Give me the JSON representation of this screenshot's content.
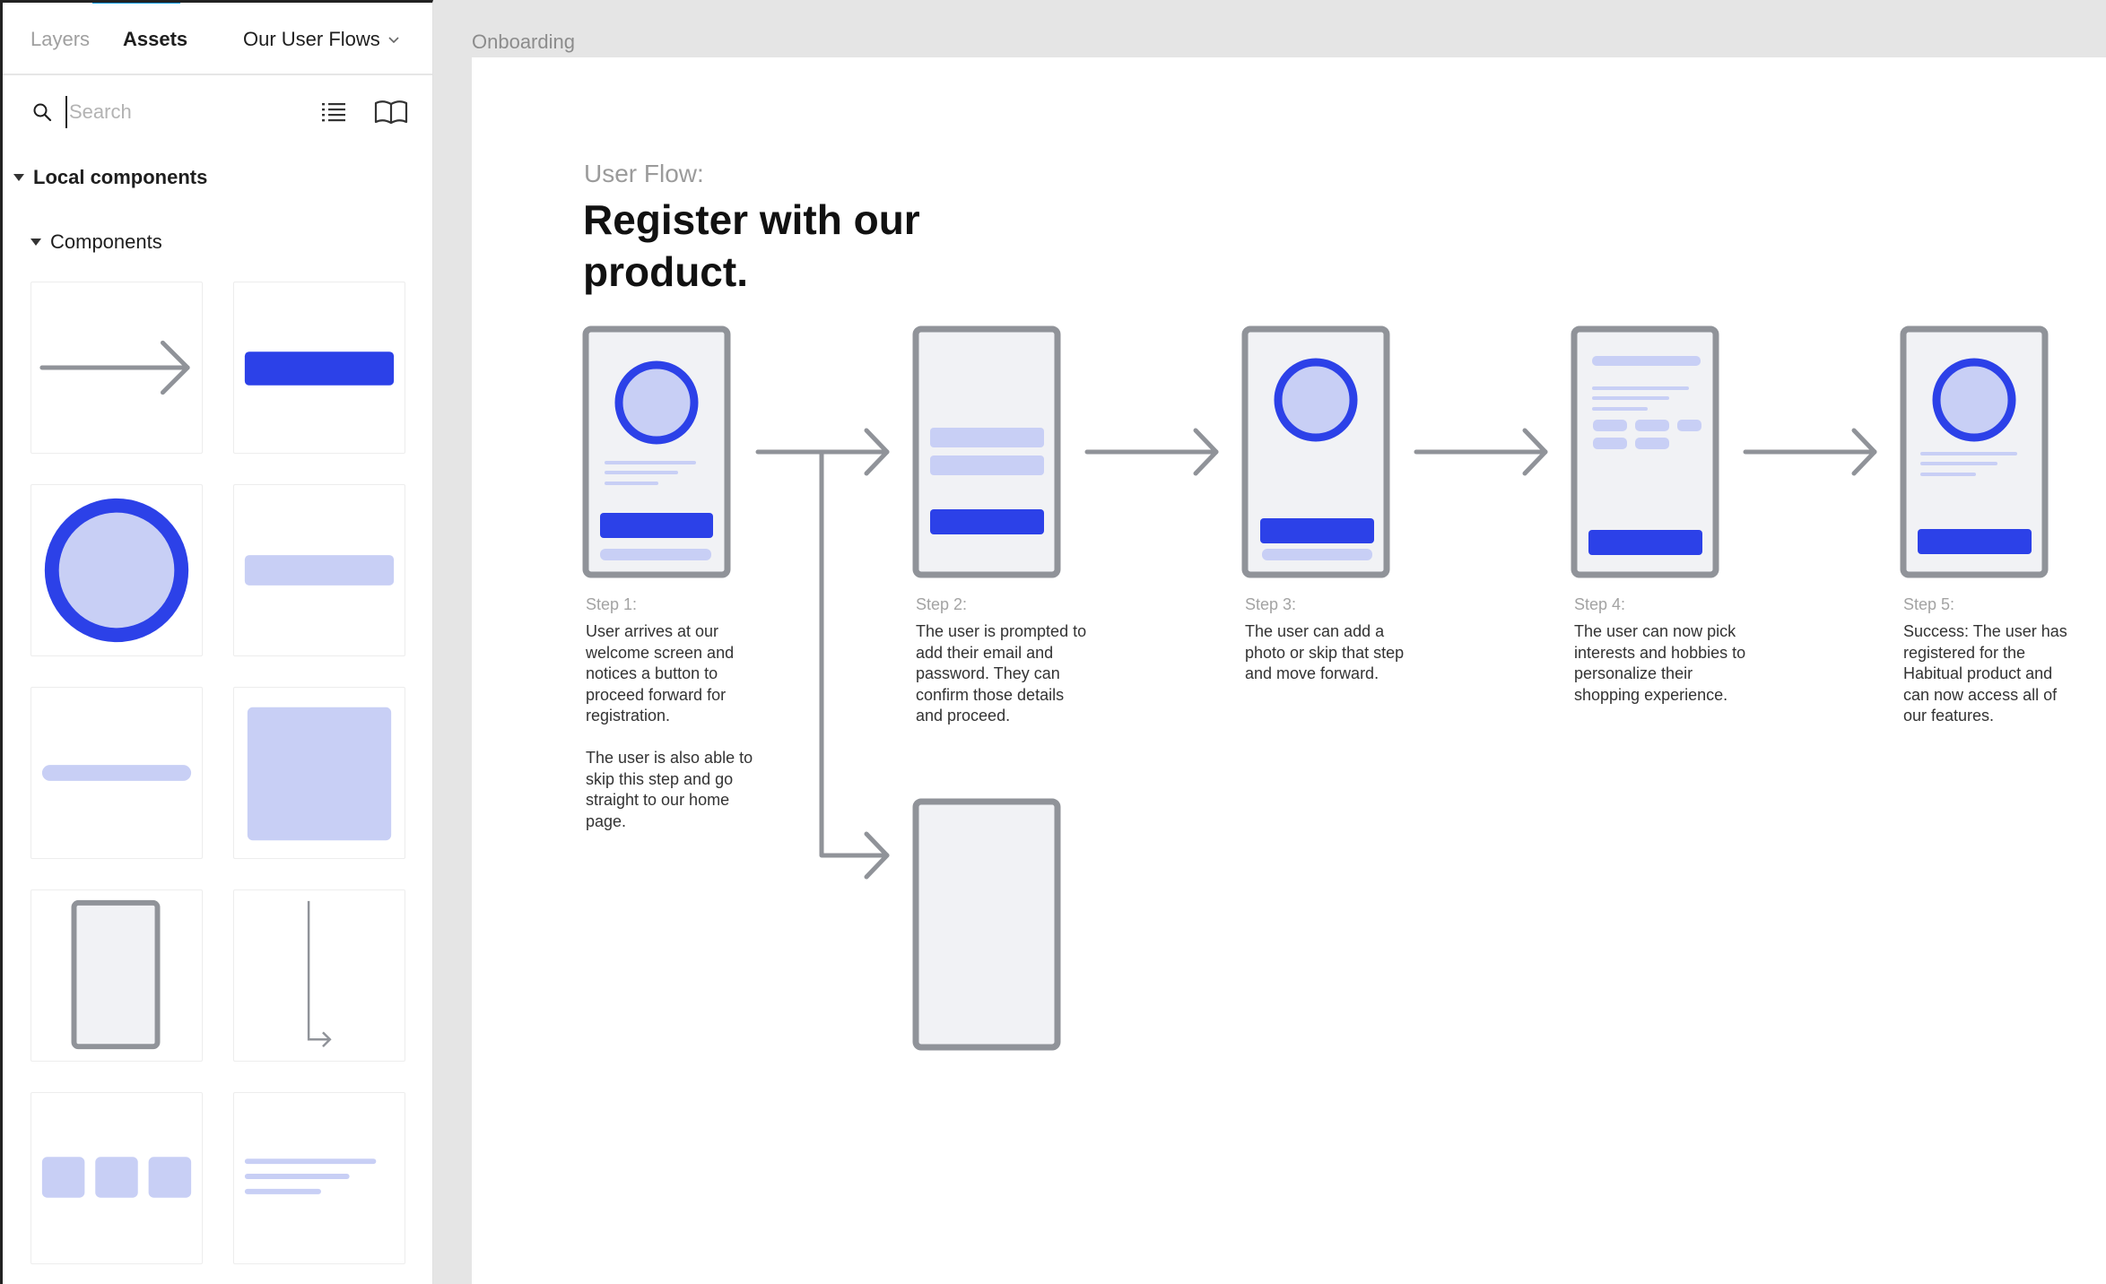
{
  "sidebar": {
    "tabs": {
      "layers": "Layers",
      "assets": "Assets"
    },
    "page_switcher": "Our User Flows",
    "search": {
      "placeholder": "Search",
      "value": ""
    },
    "local_components_label": "Local components",
    "components_group_label": "Components"
  },
  "canvas": {
    "frame_label": "Onboarding",
    "flow_overline": "User Flow:",
    "flow_title": "Register with our product.",
    "steps": [
      {
        "label": "Step 1:",
        "description": "User arrives at our welcome screen and notices a button to proceed forward for registration.\n\nThe user is also able to skip this step and go straight to our home page."
      },
      {
        "label": "Step 2:",
        "description": "The user is prompted to add their email and password. They can confirm those details and proceed."
      },
      {
        "label": "Step 3:",
        "description": "The user can add a photo or skip that step and move forward."
      },
      {
        "label": "Step 4:",
        "description": "The user can now pick interests and hobbies to personalize their shopping experience."
      },
      {
        "label": "Step 5:",
        "description": "Success: The user has registered for the Habitual product and can now access all of our features."
      }
    ]
  },
  "colors": {
    "accent_blue": "#2c41e8",
    "light_blue": "#c8cff5",
    "phone_gray": "#909399",
    "phone_fill": "#f1f2f5",
    "selection_blue": "#18a0fb"
  }
}
